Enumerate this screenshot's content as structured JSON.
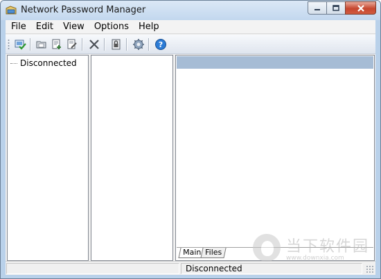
{
  "window": {
    "title": "Network Password Manager"
  },
  "menu": {
    "items": [
      {
        "label": "File"
      },
      {
        "label": "Edit"
      },
      {
        "label": "View"
      },
      {
        "label": "Options"
      },
      {
        "label": "Help"
      }
    ]
  },
  "toolbar": {
    "icons": [
      "connect-icon",
      "new-folder-icon",
      "new-item-icon",
      "edit-item-icon",
      "delete-icon",
      "lock-icon",
      "settings-icon",
      "help-icon"
    ]
  },
  "tree": {
    "root_label": "Disconnected"
  },
  "tabs": [
    {
      "label": "Main"
    },
    {
      "label": "Files"
    }
  ],
  "status": {
    "left": "",
    "right": "Disconnected"
  },
  "watermark": {
    "text": "当下软件园",
    "url": "www.downxia.com"
  },
  "colors": {
    "title_bg": "#c2d7ee",
    "selection": "#a6bcd5",
    "close_button": "#c6472f"
  }
}
